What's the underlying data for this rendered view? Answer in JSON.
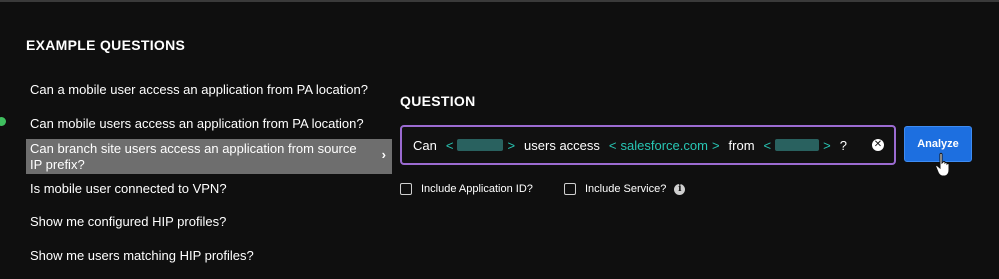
{
  "section_title": "EXAMPLE QUESTIONS",
  "examples": [
    {
      "text": "Can a mobile user access an application from PA location?"
    },
    {
      "text": "Can mobile users access an application from PA location?"
    },
    {
      "text": "Can branch site users access an application from source IP prefix?",
      "selected": true
    },
    {
      "text": "Is mobile user connected to VPN?"
    },
    {
      "text": "Show me configured HIP profiles?"
    },
    {
      "text": "Show me users matching HIP profiles?"
    }
  ],
  "question_title": "QUESTION",
  "query": {
    "word_can": "Can",
    "slot_open": "<",
    "slot_close": ">",
    "word_users_access": "users access",
    "app_value": "salesforce.com",
    "word_from": "from",
    "word_q": "?"
  },
  "analyze_label": "Analyze",
  "options": {
    "include_app_id": "Include Application ID?",
    "include_service": "Include Service?"
  },
  "icons": {
    "clear": "close-circle-icon",
    "chevron": "chevron-right-icon",
    "info": "info-icon",
    "status": "check-dot-icon",
    "cursor": "hand-pointer-icon"
  },
  "colors": {
    "background": "#0f0f0f",
    "accent_border": "#9b6bd1",
    "slot_text": "#28c6b4",
    "button": "#1d6fe0",
    "selected_row": "#6e6e6e"
  }
}
